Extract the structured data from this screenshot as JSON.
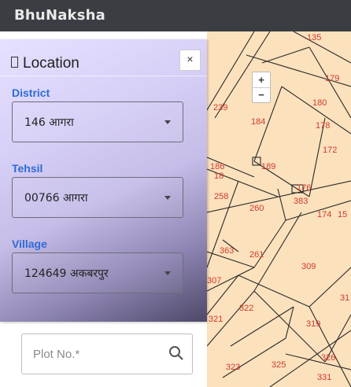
{
  "app": {
    "title": "BhuNaksha"
  },
  "panel": {
    "title": "Location",
    "close_label": "×",
    "district": {
      "label": "District",
      "value": "146 आगरा"
    },
    "tehsil": {
      "label": "Tehsil",
      "value": "00766 आगरा"
    },
    "village": {
      "label": "Village",
      "value": "124649 अकबरपुर"
    }
  },
  "plot_search": {
    "placeholder": "Plot No.*"
  },
  "map": {
    "zoom_in_label": "+",
    "zoom_out_label": "−",
    "parcels": [
      "135",
      "179",
      "239",
      "184",
      "180",
      "178",
      "172",
      "186",
      "189",
      "18",
      "176",
      "258",
      "260",
      "383",
      "174",
      "15",
      "363",
      "261",
      "309",
      "307",
      "31",
      "322",
      "321",
      "319",
      "323",
      "325",
      "326",
      "331"
    ]
  },
  "colors": {
    "topbar": "#3a3d42",
    "accent_label": "#2e6bd6",
    "map_fill": "#fbe1bc",
    "parcel_text": "#d03a2e"
  }
}
